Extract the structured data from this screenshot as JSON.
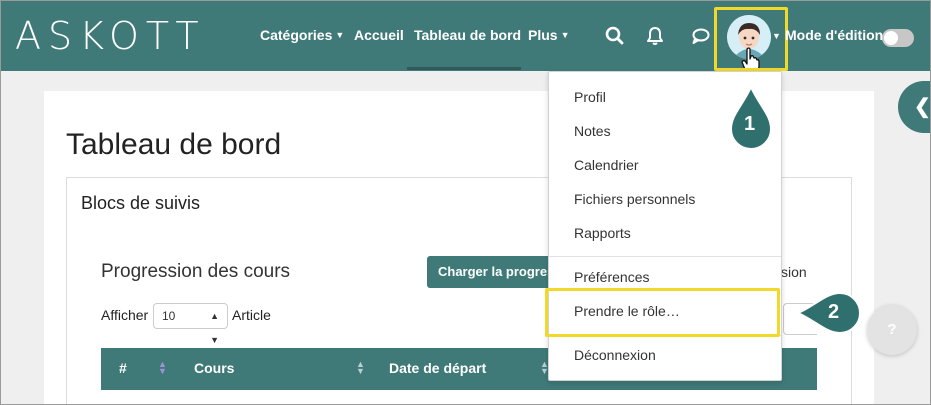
{
  "brand": {
    "logo_text": "ASKOTT"
  },
  "nav": {
    "items": [
      {
        "label": "Catégories",
        "has_dropdown": true
      },
      {
        "label": "Accueil",
        "has_dropdown": false
      },
      {
        "label": "Tableau de bord",
        "has_dropdown": false,
        "active": true
      },
      {
        "label": "Plus",
        "has_dropdown": true
      }
    ],
    "icons": [
      "search-icon",
      "bell-icon",
      "chat-icon"
    ],
    "edit_mode_label": "Mode d'édition",
    "edit_mode_on": false
  },
  "page": {
    "title": "Tableau de bord",
    "block_title": "Blocs de suivis",
    "progress_title": "Progression des cours",
    "load_button": "Charger la progression",
    "partial_text": "sion",
    "show_label": "Afficher",
    "show_value": "10",
    "article_label": "Article",
    "table_headers": [
      "#",
      "Cours",
      "Date de départ"
    ]
  },
  "user_menu": {
    "items": [
      "Profil",
      "Notes",
      "Calendrier",
      "Fichiers personnels",
      "Rapports",
      "Préférences",
      "Prendre le rôle…",
      "Déconnexion"
    ],
    "highlighted": "Prendre le rôle…"
  },
  "callouts": {
    "first": "1",
    "second": "2"
  },
  "help": {
    "label": "?"
  },
  "colors": {
    "primary": "#3f7a79",
    "highlight": "#f1d92a",
    "callout": "#2f6f6d"
  }
}
